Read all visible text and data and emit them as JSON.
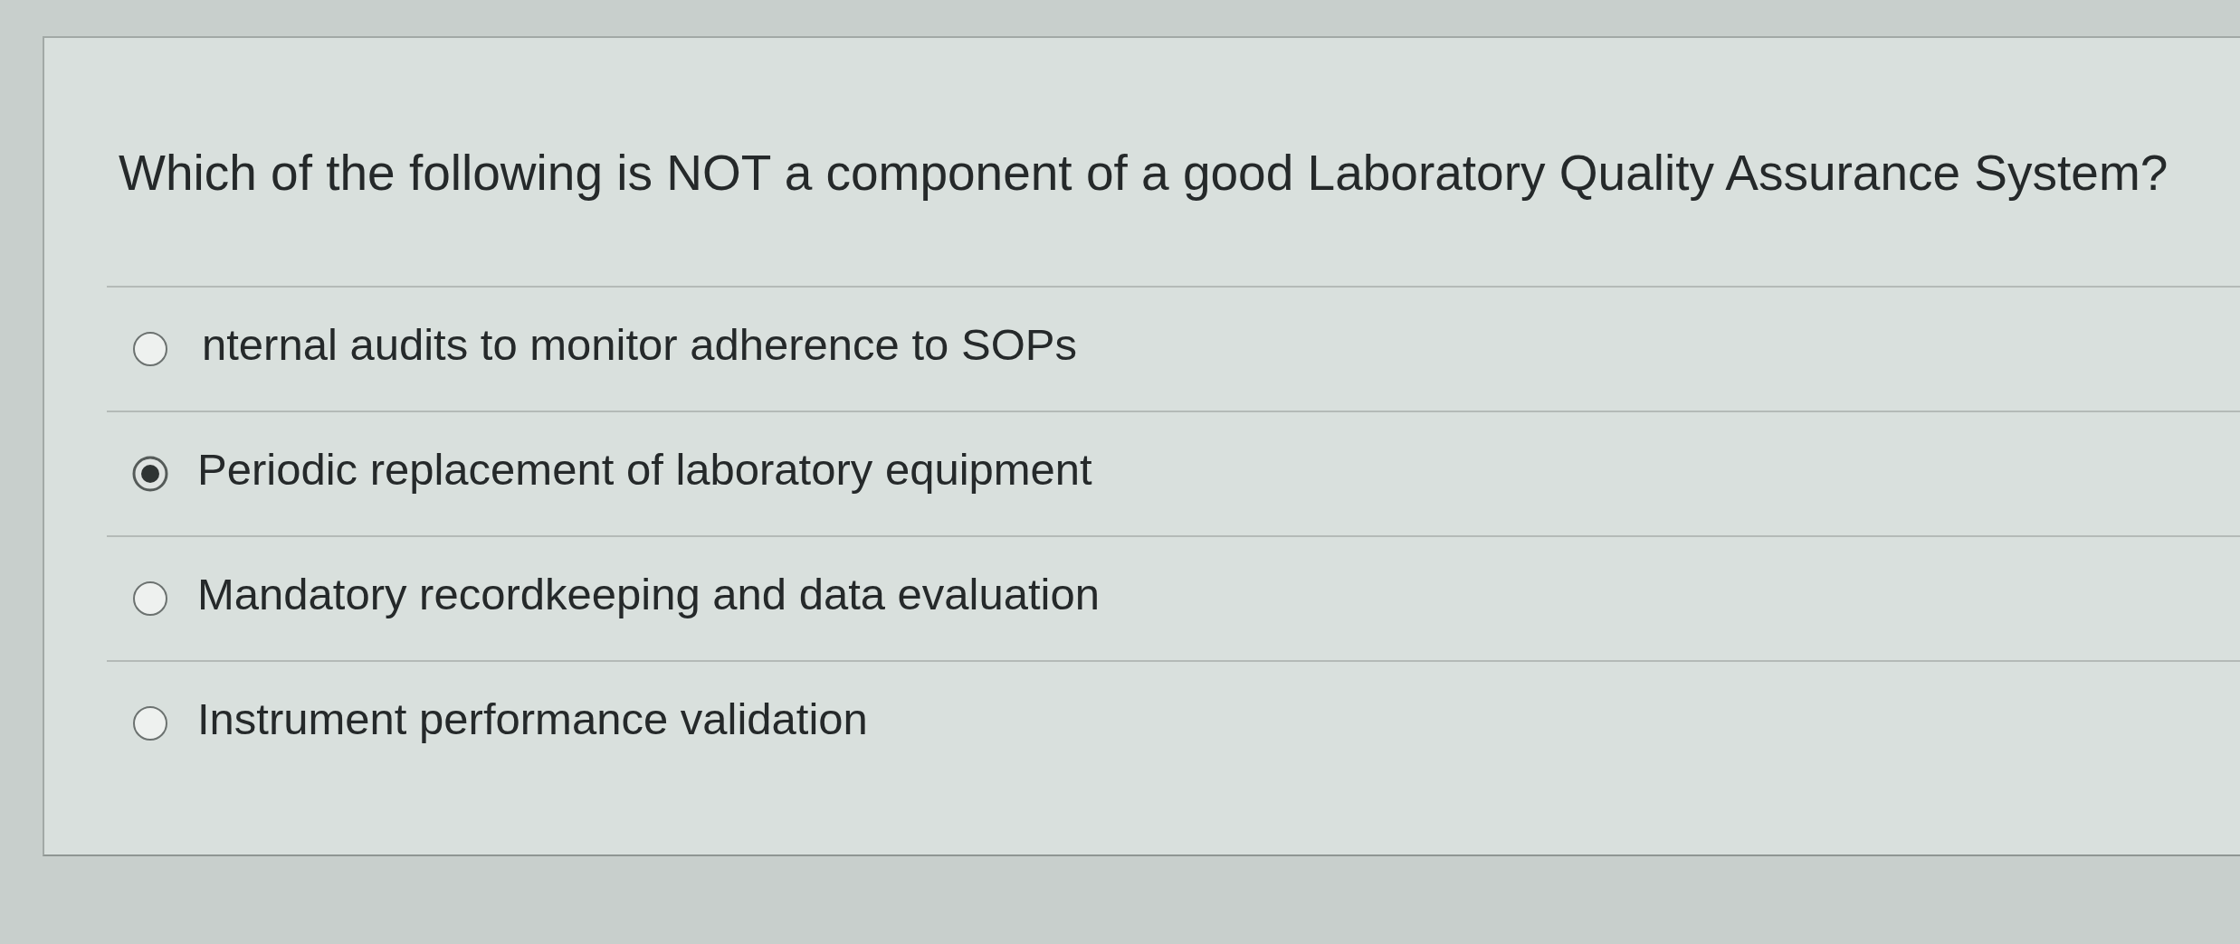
{
  "question": {
    "text": "Which of the following is NOT a component of a good Laboratory Quality Assurance System?"
  },
  "options": [
    {
      "label": "nternal audits to monitor adherence to SOPs",
      "selected": false
    },
    {
      "label": "Periodic replacement of laboratory equipment",
      "selected": true
    },
    {
      "label": "Mandatory recordkeeping and data evaluation",
      "selected": false
    },
    {
      "label": "Instrument performance validation",
      "selected": false
    }
  ]
}
